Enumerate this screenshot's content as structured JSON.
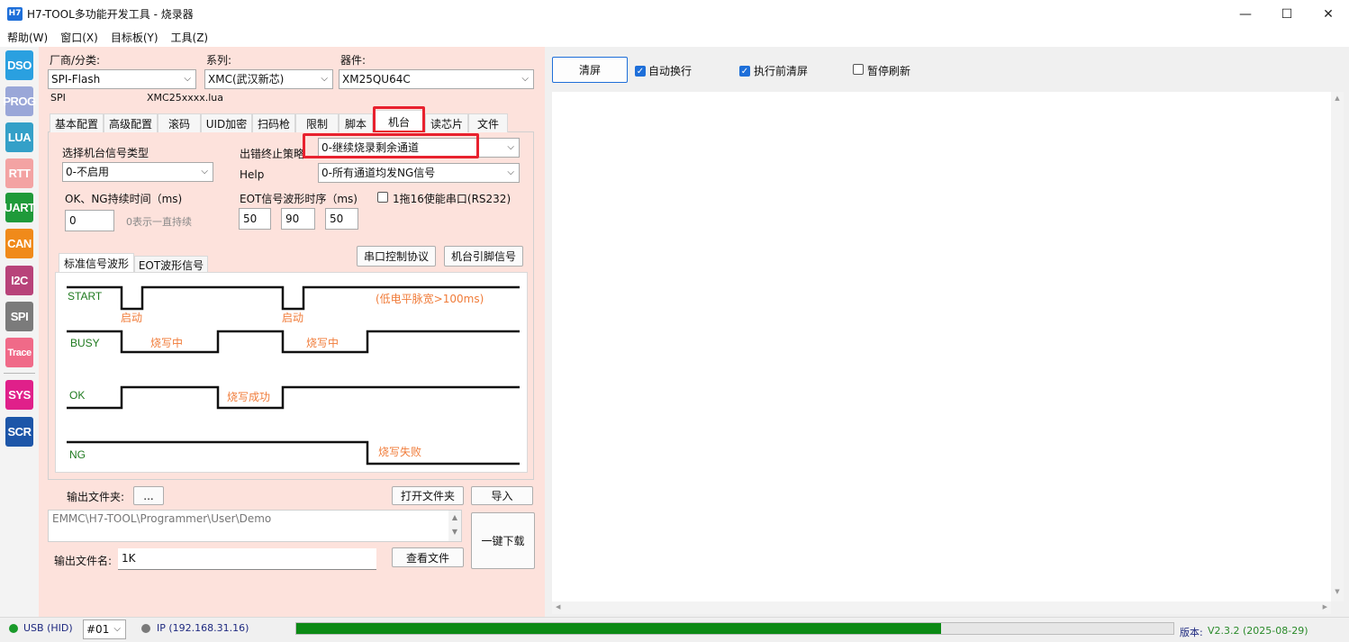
{
  "window": {
    "app_icon": "H7",
    "title": "H7-TOOL多功能开发工具 - 烧录器",
    "minimize_icon": "—",
    "maximize_icon": "☐",
    "close_icon": "✕"
  },
  "menu": [
    "帮助(W)",
    "窗口(X)",
    "目标板(Y)",
    "工具(Z)"
  ],
  "sidebar": [
    {
      "label": "DSO",
      "color": "#2aa0e0"
    },
    {
      "label": "PROG",
      "color": "#9aa7d8"
    },
    {
      "label": "LUA",
      "color": "#34a0c8"
    },
    {
      "label": "RTT",
      "color": "#f3a3a3"
    },
    {
      "label": "UART",
      "color": "#1f9a3a"
    },
    {
      "label": "CAN",
      "color": "#f08a1a"
    },
    {
      "label": "I2C",
      "color": "#b8437a"
    },
    {
      "label": "SPI",
      "color": "#7b7b7b"
    },
    {
      "label": "Trace",
      "color": "#f06a88"
    },
    {
      "label": "SYS",
      "color": "#e0208a"
    },
    {
      "label": "SCR",
      "color": "#1d56a8"
    }
  ],
  "device": {
    "vendor_label": "厂商/分类:",
    "vendor_value": "SPI-Flash",
    "series_label": "系列:",
    "series_value": "XMC(武汉新芯)",
    "part_label": "器件:",
    "part_value": "XM25QU64C",
    "bus": "SPI",
    "lua_file": "XMC25xxxx.lua"
  },
  "tabs": [
    "基本配置",
    "高级配置",
    "滚码",
    "UID加密",
    "扫码枪",
    "限制",
    "脚本",
    "机台",
    "读芯片",
    "文件"
  ],
  "machine": {
    "signal_type_label": "选择机台信号类型",
    "signal_type_value": "0-不启用",
    "error_policy_label": "出错终止策略",
    "error_policy_value": "0-继续烧录剩余通道",
    "help_label": "Help",
    "help_value": "0-所有通道均发NG信号",
    "duration_label": "OK、NG持续时间（ms)",
    "duration_value": "0",
    "duration_hint": "0表示一直持续",
    "eot_label": "EOT信号波形时序（ms)",
    "eot_values": [
      "50",
      "90",
      "50"
    ],
    "serial_enable_label": "1拖16使能串口(RS232)",
    "serial_protocol_button": "串口控制协议",
    "pin_signal_button": "机台引脚信号",
    "subtabs": [
      "标准信号波形",
      "EOT波形信号"
    ]
  },
  "waveform": {
    "signals": [
      "START",
      "BUSY",
      "OK",
      "NG"
    ],
    "start_annotations": [
      "启动",
      "启动"
    ],
    "pulse_note": "(低电平脉宽>100ms)",
    "busy_annotations": [
      "烧写中",
      "烧写中"
    ],
    "ok_annotation": "烧写成功",
    "ng_annotation": "烧写失败"
  },
  "output": {
    "folder_label": "输出文件夹:",
    "browse_button": "...",
    "open_folder_button": "打开文件夹",
    "import_button": "导入",
    "path": "EMMC\\H7-TOOL\\Programmer\\User\\Demo",
    "download_button": "一键下载",
    "filename_label": "输出文件名:",
    "filename_value": "1K",
    "view_file_button": "查看文件"
  },
  "right": {
    "clear_button": "清屏",
    "auto_wrap_label": "自动换行",
    "auto_wrap_checked": true,
    "clear_before_label": "执行前清屏",
    "clear_before_checked": true,
    "pause_refresh_label": "暂停刷新",
    "pause_refresh_checked": false
  },
  "status": {
    "usb": "USB (HID)",
    "usb_color": "#1a9a2a",
    "channel": "#01",
    "ip": "IP (192.168.31.16)",
    "ip_color": "#7a7a7a",
    "progress": 0.735,
    "version_label": "版本:",
    "version_value": "V2.3.2 (2025-08-29)"
  }
}
